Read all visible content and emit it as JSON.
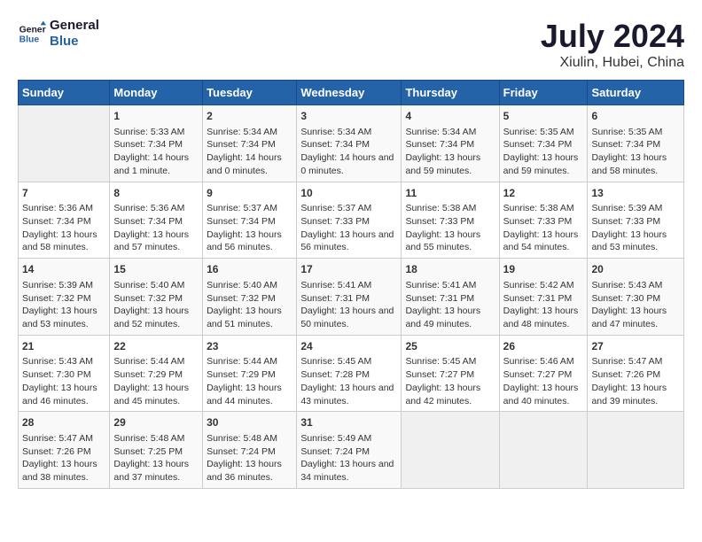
{
  "header": {
    "logo_line1": "General",
    "logo_line2": "Blue",
    "title": "July 2024",
    "subtitle": "Xiulin, Hubei, China"
  },
  "weekdays": [
    "Sunday",
    "Monday",
    "Tuesday",
    "Wednesday",
    "Thursday",
    "Friday",
    "Saturday"
  ],
  "weeks": [
    [
      {
        "day": "",
        "empty": true
      },
      {
        "day": "1",
        "sunrise": "Sunrise: 5:33 AM",
        "sunset": "Sunset: 7:34 PM",
        "daylight": "Daylight: 14 hours and 1 minute."
      },
      {
        "day": "2",
        "sunrise": "Sunrise: 5:34 AM",
        "sunset": "Sunset: 7:34 PM",
        "daylight": "Daylight: 14 hours and 0 minutes."
      },
      {
        "day": "3",
        "sunrise": "Sunrise: 5:34 AM",
        "sunset": "Sunset: 7:34 PM",
        "daylight": "Daylight: 14 hours and 0 minutes."
      },
      {
        "day": "4",
        "sunrise": "Sunrise: 5:34 AM",
        "sunset": "Sunset: 7:34 PM",
        "daylight": "Daylight: 13 hours and 59 minutes."
      },
      {
        "day": "5",
        "sunrise": "Sunrise: 5:35 AM",
        "sunset": "Sunset: 7:34 PM",
        "daylight": "Daylight: 13 hours and 59 minutes."
      },
      {
        "day": "6",
        "sunrise": "Sunrise: 5:35 AM",
        "sunset": "Sunset: 7:34 PM",
        "daylight": "Daylight: 13 hours and 58 minutes."
      }
    ],
    [
      {
        "day": "7",
        "sunrise": "Sunrise: 5:36 AM",
        "sunset": "Sunset: 7:34 PM",
        "daylight": "Daylight: 13 hours and 58 minutes."
      },
      {
        "day": "8",
        "sunrise": "Sunrise: 5:36 AM",
        "sunset": "Sunset: 7:34 PM",
        "daylight": "Daylight: 13 hours and 57 minutes."
      },
      {
        "day": "9",
        "sunrise": "Sunrise: 5:37 AM",
        "sunset": "Sunset: 7:34 PM",
        "daylight": "Daylight: 13 hours and 56 minutes."
      },
      {
        "day": "10",
        "sunrise": "Sunrise: 5:37 AM",
        "sunset": "Sunset: 7:33 PM",
        "daylight": "Daylight: 13 hours and 56 minutes."
      },
      {
        "day": "11",
        "sunrise": "Sunrise: 5:38 AM",
        "sunset": "Sunset: 7:33 PM",
        "daylight": "Daylight: 13 hours and 55 minutes."
      },
      {
        "day": "12",
        "sunrise": "Sunrise: 5:38 AM",
        "sunset": "Sunset: 7:33 PM",
        "daylight": "Daylight: 13 hours and 54 minutes."
      },
      {
        "day": "13",
        "sunrise": "Sunrise: 5:39 AM",
        "sunset": "Sunset: 7:33 PM",
        "daylight": "Daylight: 13 hours and 53 minutes."
      }
    ],
    [
      {
        "day": "14",
        "sunrise": "Sunrise: 5:39 AM",
        "sunset": "Sunset: 7:32 PM",
        "daylight": "Daylight: 13 hours and 53 minutes."
      },
      {
        "day": "15",
        "sunrise": "Sunrise: 5:40 AM",
        "sunset": "Sunset: 7:32 PM",
        "daylight": "Daylight: 13 hours and 52 minutes."
      },
      {
        "day": "16",
        "sunrise": "Sunrise: 5:40 AM",
        "sunset": "Sunset: 7:32 PM",
        "daylight": "Daylight: 13 hours and 51 minutes."
      },
      {
        "day": "17",
        "sunrise": "Sunrise: 5:41 AM",
        "sunset": "Sunset: 7:31 PM",
        "daylight": "Daylight: 13 hours and 50 minutes."
      },
      {
        "day": "18",
        "sunrise": "Sunrise: 5:41 AM",
        "sunset": "Sunset: 7:31 PM",
        "daylight": "Daylight: 13 hours and 49 minutes."
      },
      {
        "day": "19",
        "sunrise": "Sunrise: 5:42 AM",
        "sunset": "Sunset: 7:31 PM",
        "daylight": "Daylight: 13 hours and 48 minutes."
      },
      {
        "day": "20",
        "sunrise": "Sunrise: 5:43 AM",
        "sunset": "Sunset: 7:30 PM",
        "daylight": "Daylight: 13 hours and 47 minutes."
      }
    ],
    [
      {
        "day": "21",
        "sunrise": "Sunrise: 5:43 AM",
        "sunset": "Sunset: 7:30 PM",
        "daylight": "Daylight: 13 hours and 46 minutes."
      },
      {
        "day": "22",
        "sunrise": "Sunrise: 5:44 AM",
        "sunset": "Sunset: 7:29 PM",
        "daylight": "Daylight: 13 hours and 45 minutes."
      },
      {
        "day": "23",
        "sunrise": "Sunrise: 5:44 AM",
        "sunset": "Sunset: 7:29 PM",
        "daylight": "Daylight: 13 hours and 44 minutes."
      },
      {
        "day": "24",
        "sunrise": "Sunrise: 5:45 AM",
        "sunset": "Sunset: 7:28 PM",
        "daylight": "Daylight: 13 hours and 43 minutes."
      },
      {
        "day": "25",
        "sunrise": "Sunrise: 5:45 AM",
        "sunset": "Sunset: 7:27 PM",
        "daylight": "Daylight: 13 hours and 42 minutes."
      },
      {
        "day": "26",
        "sunrise": "Sunrise: 5:46 AM",
        "sunset": "Sunset: 7:27 PM",
        "daylight": "Daylight: 13 hours and 40 minutes."
      },
      {
        "day": "27",
        "sunrise": "Sunrise: 5:47 AM",
        "sunset": "Sunset: 7:26 PM",
        "daylight": "Daylight: 13 hours and 39 minutes."
      }
    ],
    [
      {
        "day": "28",
        "sunrise": "Sunrise: 5:47 AM",
        "sunset": "Sunset: 7:26 PM",
        "daylight": "Daylight: 13 hours and 38 minutes."
      },
      {
        "day": "29",
        "sunrise": "Sunrise: 5:48 AM",
        "sunset": "Sunset: 7:25 PM",
        "daylight": "Daylight: 13 hours and 37 minutes."
      },
      {
        "day": "30",
        "sunrise": "Sunrise: 5:48 AM",
        "sunset": "Sunset: 7:24 PM",
        "daylight": "Daylight: 13 hours and 36 minutes."
      },
      {
        "day": "31",
        "sunrise": "Sunrise: 5:49 AM",
        "sunset": "Sunset: 7:24 PM",
        "daylight": "Daylight: 13 hours and 34 minutes."
      },
      {
        "day": "",
        "empty": true
      },
      {
        "day": "",
        "empty": true
      },
      {
        "day": "",
        "empty": true
      }
    ]
  ]
}
